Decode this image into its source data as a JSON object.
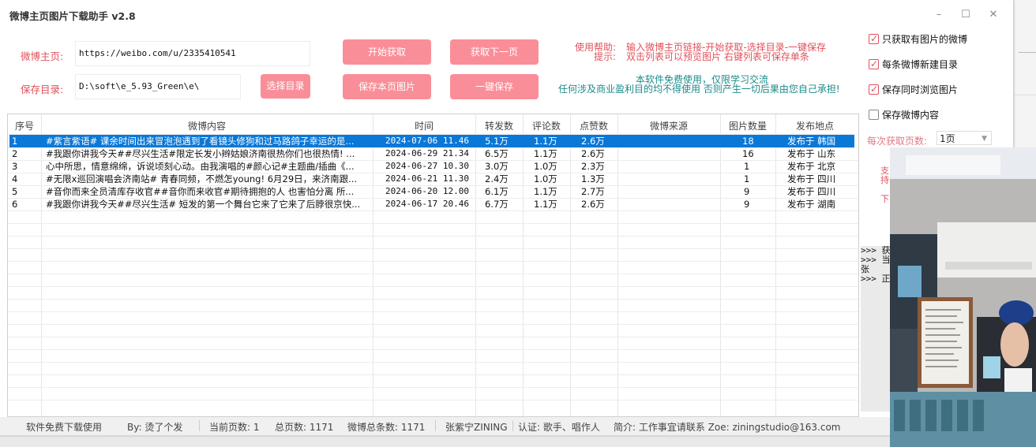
{
  "window": {
    "title": "微博主页图片下载助手 v2.8",
    "min_icon": "minimize-icon",
    "max_icon": "maximize-icon",
    "close_icon": "close-icon"
  },
  "form": {
    "home_label": "微博主页:",
    "home_value": "https://weibo.com/u/2335410541",
    "dir_label": "保存目录:",
    "dir_value": "D:\\soft\\e_5.93_Green\\e\\",
    "choose_dir_btn": "选择目录"
  },
  "buttons": {
    "start": "开始获取",
    "next_page": "获取下一页",
    "save_page": "保存本页图片",
    "save_all": "一键保存"
  },
  "help": {
    "line1_label": "使用帮助:",
    "line1_text": "输入微博主页链接-开始获取-选择目录-一键保存",
    "line2_label": "提示:",
    "line2_text": "双击列表可以预览图片 右键列表可保存单条"
  },
  "notice": {
    "line1": "本软件免费使用，仅限学习交流",
    "line2": "任何涉及商业盈利目的均不得使用 否则产生一切后果由您自己承担!"
  },
  "options": {
    "only_images": {
      "label": "只获取有图片的微博",
      "checked": true
    },
    "new_dir": {
      "label": "每条微博新建目录",
      "checked": true
    },
    "browse_images": {
      "label": "保存同时浏览图片",
      "checked": true
    },
    "save_content": {
      "label": "保存微博内容",
      "checked": false
    },
    "pages_label": "每次获取页数:",
    "pages_value": "1页"
  },
  "table": {
    "headers": [
      "序号",
      "微博内容",
      "时间",
      "转发数",
      "评论数",
      "点赞数",
      "微博来源",
      "图片数量",
      "发布地点"
    ],
    "rows": [
      [
        "1",
        "#紫言紫语# 课余时间出来冒泡泡遇到了看镜头修狗和过马路鸽子幸运的是...",
        "2024-07-06 11.46",
        "5.1万",
        "1.1万",
        "2.6万",
        "",
        "18",
        "发布于 韩国"
      ],
      [
        "2",
        "#我跟你讲我今天##尽兴生活#限定长发小辫姑娘济南很热你们也很热情! ...",
        "2024-06-29 21.34",
        "6.5万",
        "1.1万",
        "2.6万",
        "",
        "16",
        "发布于 山东"
      ],
      [
        "3",
        "心中所思，情意绵绵，诉说顷刻心动。由我演唱的#颜心记#主题曲/插曲《...",
        "2024-06-27 10.30",
        "3.0万",
        "1.0万",
        "2.3万",
        "",
        "1",
        "发布于 北京"
      ],
      [
        "4",
        "#无限x巡回演唱会济南站# 青春同频，不燃怎young! 6月29日，来济南跟...",
        "2024-06-21 11.30",
        "2.4万",
        "1.0万",
        "1.3万",
        "",
        "1",
        "发布于 四川"
      ],
      [
        "5",
        "#音你而来全员清库存收官##音你而来收官#期待拥抱的人 也害怕分离 所...",
        "2024-06-20 12.00",
        "6.1万",
        "1.1万",
        "2.7万",
        "",
        "9",
        "发布于 四川"
      ],
      [
        "6",
        "#我跟你讲我今天##尽兴生活# 短发的第一个舞台它来了它来了后脖很京快...",
        "2024-06-17 20.46",
        "6.7万",
        "1.1万",
        "2.6万",
        "",
        "9",
        "发布于 湖南"
      ]
    ],
    "selected_row": 0
  },
  "log": [
    "获",
    "当",
    "张",
    "正"
  ],
  "side_fragment": [
    "支",
    "持",
    "下"
  ],
  "status": {
    "free": "软件免费下载使用",
    "by": "By: 烫了个发",
    "current_page": "当前页数: 1",
    "total_pages": "总页数: 1171",
    "total_posts": "微博总条数: 1171",
    "user": "张紫宁ZINING",
    "verify": "认证: 歌手、唱作人",
    "intro": "简介: 工作事宜请联系 Zoe: ziningstudio@163.com"
  },
  "colors": {
    "accent_red": "#e0505a",
    "button_pink": "#fa8e98",
    "notice_teal": "#1a8a8a",
    "selection_blue": "#0a78d7"
  }
}
